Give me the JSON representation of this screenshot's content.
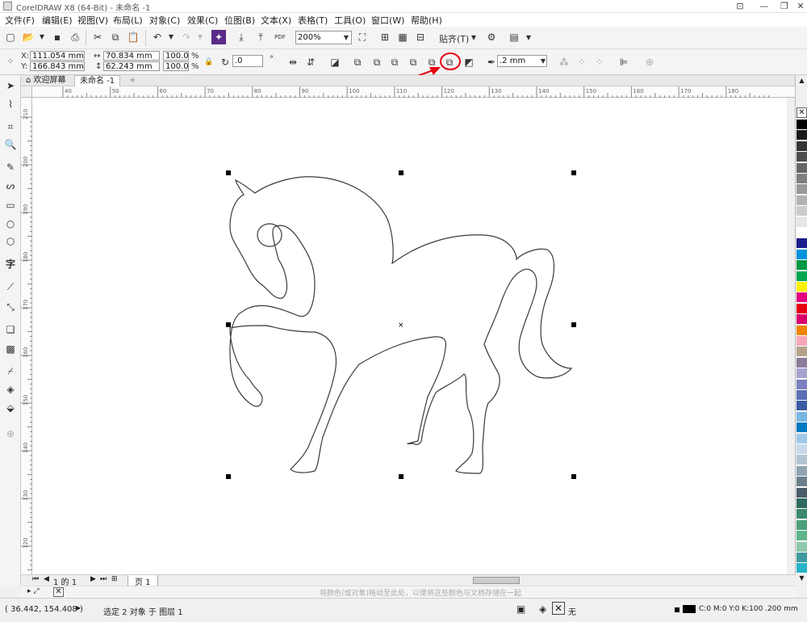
{
  "window": {
    "title": "CorelDRAW X8 (64-Bit) - 未命名 -1"
  },
  "menu": [
    "文件(F)",
    "编辑(E)",
    "视图(V)",
    "布局(L)",
    "对象(C)",
    "效果(C)",
    "位图(B)",
    "文本(X)",
    "表格(T)",
    "工具(O)",
    "窗口(W)",
    "帮助(H)"
  ],
  "toolbar": {
    "zoom": "200%",
    "snap_label": "贴齐(T)",
    "pdf_label": "PDF"
  },
  "props": {
    "x": "111.054 mm",
    "y": "166.843 mm",
    "w": "70.834 mm",
    "h": "62.243 mm",
    "sx": "100.0",
    "sy": "100.0",
    "pct": "%",
    "rotation": ".0",
    "outline": ".2 mm"
  },
  "tabs": {
    "welcome": "欢迎屏幕",
    "doc": "未命名 -1",
    "add": "+"
  },
  "ruler": {
    "h_ticks": [
      "40",
      "50",
      "60",
      "70",
      "80",
      "90",
      "100",
      "110",
      "120",
      "130",
      "140",
      "150",
      "160",
      "170",
      "180"
    ],
    "v_ticks": [
      "210",
      "200",
      "190",
      "180",
      "170",
      "160",
      "150",
      "140",
      "130",
      "120"
    ]
  },
  "pagebar": {
    "pages": "1 的 1",
    "page_tab": "页 1"
  },
  "colorbar": {
    "hint": "将颜色(或对象)拖动至此处，以便将这些颜色与文档存储在一起"
  },
  "status": {
    "coords": "( 36.442, 154.408 )",
    "selection": "选定 2 对象 于 图层 1",
    "fill_none": "无",
    "outline_info": "C:0 M:0 Y:0 K:100 .200 mm"
  },
  "palette": [
    "#000000",
    "#1a1a1a",
    "#333333",
    "#4d4d4d",
    "#666666",
    "#808080",
    "#999999",
    "#b3b3b3",
    "#cccccc",
    "#e6e6e6",
    "#ffffff",
    "#1c1c8c",
    "#0093dd",
    "#009944",
    "#00a651",
    "#fff100",
    "#e4007f",
    "#e60012",
    "#d7006c",
    "#f08300",
    "#f5a7b8",
    "#b5a28a",
    "#8c7b9a",
    "#a7a2d0",
    "#7b7fbf",
    "#5b6eb4",
    "#3c5aa6",
    "#7ab6e2",
    "#0079c1",
    "#a0c8e8",
    "#c8d8e8",
    "#b3c4d0",
    "#8fa3b0",
    "#6c7f8c",
    "#4a5c68",
    "#2e6b5e",
    "#3c8a6e",
    "#4ca07a",
    "#5eb588",
    "#8cc9a8",
    "#3f9a9f",
    "#28b3c9"
  ],
  "accent": "#e60012"
}
